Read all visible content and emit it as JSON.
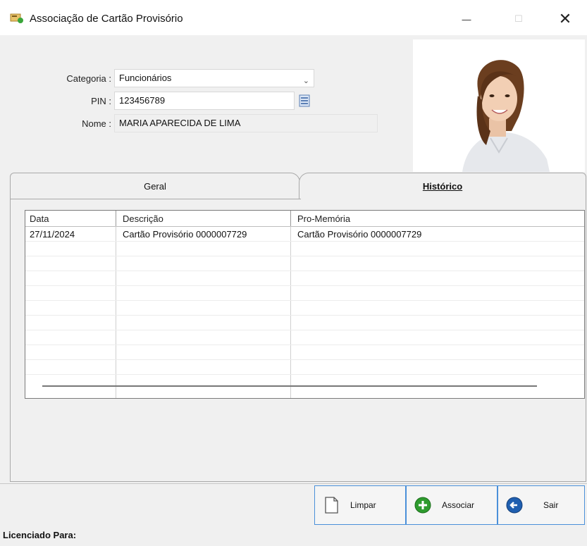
{
  "window": {
    "title": "Associação de Cartão Provisório",
    "minimize_glyph": "—",
    "maximize_glyph": "☐",
    "close_glyph": "✕"
  },
  "form": {
    "categoria_label": "Categoria :",
    "categoria_value": "Funcionários",
    "pin_label": "PIN :",
    "pin_value": "123456789",
    "nome_label": "Nome :",
    "nome_value": "MARIA APARECIDA DE LIMA"
  },
  "tabs": [
    {
      "label": "Geral",
      "active": false
    },
    {
      "label": "Histórico",
      "active": true
    }
  ],
  "grid": {
    "columns": [
      "Data",
      "Descrição",
      "Pro-Memória"
    ],
    "rows": [
      [
        "27/11/2024",
        "Cartão Provisório 0000007729",
        "Cartão Provisório 0000007729"
      ]
    ]
  },
  "buttons": {
    "limpar": "Limpar",
    "associar": "Associar",
    "sair": "Sair"
  },
  "status": {
    "licenciado": "Licenciado Para:"
  },
  "colors": {
    "accent_border": "#4a90d9",
    "associar_icon": "#2e9b2e",
    "sair_icon": "#1f5fb0"
  }
}
